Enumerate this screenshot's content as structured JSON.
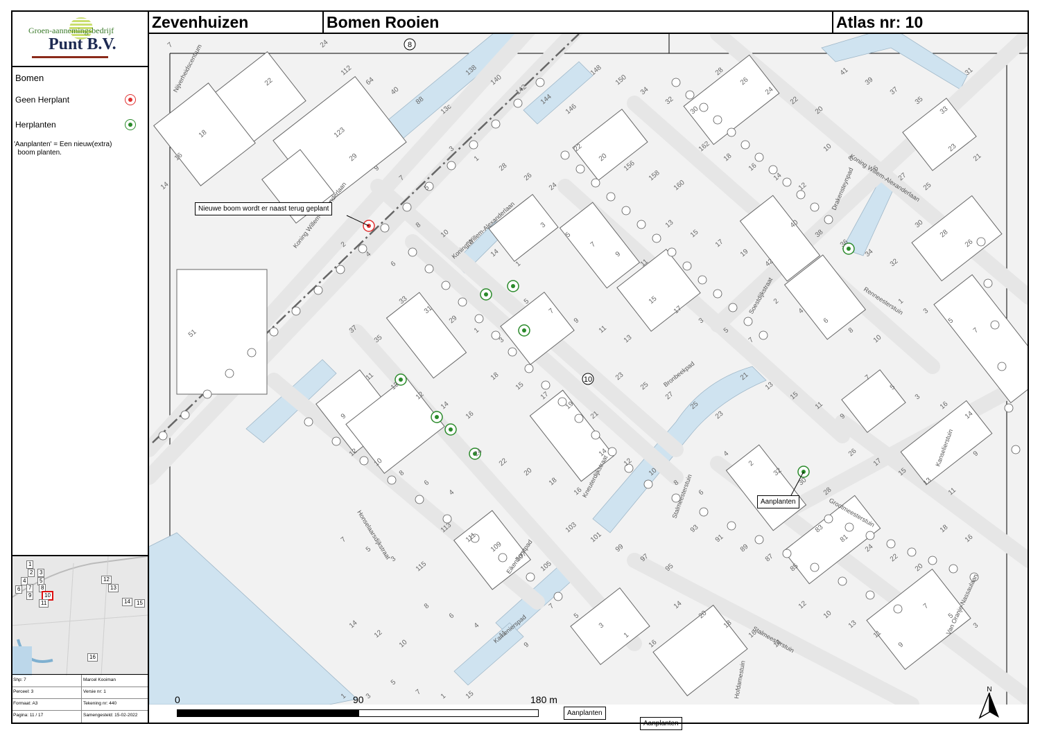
{
  "logo": {
    "top_text": "Groen-aannemingsbedrijf",
    "main_text": "Punt B.V."
  },
  "header": {
    "place": "Zevenhuizen",
    "subject": "Bomen Rooien",
    "atlas": "Atlas nr: 10"
  },
  "legend": {
    "title": "Bomen",
    "items": [
      {
        "label": "Geen Herplant",
        "color": "#e03030"
      },
      {
        "label": "Herplanten",
        "color": "#2a8a2a"
      }
    ],
    "note": "'Aanplanten' = Een nieuw(extra)\n  boom planten."
  },
  "overview": {
    "cells": [
      "1",
      "2",
      "3",
      "4",
      "5",
      "6",
      "7",
      "8",
      "9",
      "10",
      "11",
      "12",
      "13",
      "14",
      "15",
      "16"
    ],
    "active": "10"
  },
  "meta": {
    "rows": [
      {
        "left": "Shp: 7",
        "right": "Marcel Kooiman"
      },
      {
        "left": "Perceel: 3",
        "right": "Versie nr: 1"
      },
      {
        "left": "Formaat: A3",
        "right": "Tekening nr: 440"
      },
      {
        "left": "Pagina: 11 / 17",
        "right": "Samengesteld: 15-02-2022"
      }
    ]
  },
  "map": {
    "streets": [
      "Nijverheidscentrum",
      "Koning Willem-Alexanderlaan",
      "Koning Willem-Alexanderlaan",
      "Koning Willem-Alexanderlaan",
      "Drakensteynpad",
      "Soestdijkstraat",
      "Renneesterstuin",
      "Bronbeekpad",
      "Honselaarsdijkstraat",
      "Kneuterdijkstraat",
      "Eikenhorstpad",
      "Stalmeesterstuin",
      "Grootmeesterstuin",
      "Kanselierstuin",
      "Kamenierspad",
      "Stalmeesterstuin",
      "Van Oranje-Nassaulaan",
      "Hofdamestuin"
    ],
    "lot_numbers": [
      "7",
      "24",
      "22",
      "18",
      "123",
      "16",
      "14",
      "51",
      "112",
      "64",
      "40",
      "88",
      "13c",
      "138",
      "140",
      "142",
      "144",
      "146",
      "148",
      "150",
      "34",
      "32",
      "30",
      "28",
      "26",
      "24",
      "22",
      "20",
      "41",
      "39",
      "37",
      "35",
      "33",
      "31",
      "29",
      "9",
      "7",
      "5",
      "3",
      "1",
      "28",
      "26",
      "24",
      "22",
      "20",
      "156",
      "158",
      "160",
      "162",
      "18",
      "16",
      "14",
      "12",
      "10",
      "8",
      "6",
      "27",
      "25",
      "23",
      "21",
      "2",
      "4",
      "6",
      "8",
      "10",
      "12",
      "14",
      "1",
      "3",
      "5",
      "7",
      "9",
      "11",
      "13",
      "15",
      "17",
      "19",
      "42",
      "40",
      "38",
      "36",
      "34",
      "32",
      "30",
      "28",
      "26",
      "37",
      "35",
      "33",
      "31",
      "29",
      "1",
      "3",
      "5",
      "7",
      "9",
      "11",
      "13",
      "15",
      "17",
      "3",
      "5",
      "7",
      "2",
      "4",
      "6",
      "8",
      "10",
      "1",
      "3",
      "5",
      "7",
      "9",
      "11",
      "13",
      "12",
      "14",
      "16",
      "18",
      "15",
      "17",
      "19",
      "21",
      "23",
      "25",
      "27",
      "25",
      "23",
      "21",
      "13",
      "15",
      "11",
      "9",
      "7",
      "5",
      "3",
      "16",
      "14",
      "12",
      "10",
      "8",
      "6",
      "4",
      "24",
      "22",
      "20",
      "18",
      "16",
      "14",
      "12",
      "10",
      "8",
      "6",
      "4",
      "2",
      "32",
      "30",
      "28",
      "26",
      "17",
      "15",
      "13",
      "11",
      "9",
      "7",
      "5",
      "3",
      "115",
      "113",
      "111",
      "109",
      "107",
      "105",
      "103",
      "101",
      "99",
      "97",
      "95",
      "93",
      "91",
      "89",
      "87",
      "85",
      "83",
      "81",
      "24",
      "22",
      "20",
      "18",
      "16",
      "14",
      "12",
      "10",
      "8",
      "6",
      "4",
      "11",
      "9",
      "7",
      "5",
      "3",
      "1",
      "16",
      "14",
      "20",
      "18",
      "16",
      "14",
      "12",
      "10",
      "13",
      "11",
      "9",
      "7",
      "5",
      "3",
      "1",
      "3",
      "5",
      "7",
      "1",
      "15"
    ],
    "circled_numbers": [
      "8",
      "10"
    ],
    "callouts": [
      "Nieuwe boom wordt er naast terug geplant",
      "Aanplanten",
      "Aanplanten",
      "Aanplanten"
    ]
  },
  "scale": {
    "ticks": [
      "0",
      "90",
      "180 m"
    ]
  },
  "north_label": "N",
  "colors": {
    "red_tree": "#e03030",
    "green_tree": "#2a8a2a",
    "water": "#cfe3f0",
    "road": "#e6e6e6",
    "building": "#ffffff"
  }
}
